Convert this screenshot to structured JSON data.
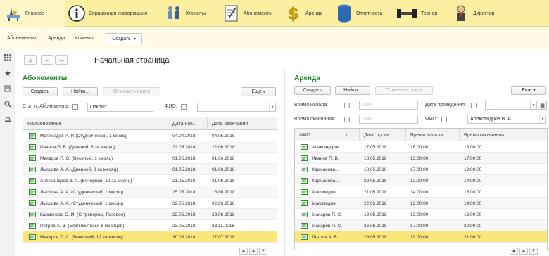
{
  "topnav": [
    {
      "label": "Главное",
      "icon": "home-desk-icon"
    },
    {
      "label": "Справочная информация",
      "icon": "info-icon"
    },
    {
      "label": "Клиенты",
      "icon": "clients-icon"
    },
    {
      "label": "Абонементы",
      "icon": "document-icon"
    },
    {
      "label": "Аренда",
      "icon": "dollar-icon"
    },
    {
      "label": "Отчетность",
      "icon": "database-icon"
    },
    {
      "label": "Тренер",
      "icon": "dumbbell-icon"
    },
    {
      "label": "Директор",
      "icon": "director-icon"
    }
  ],
  "subnav": {
    "items": [
      "Абонементы",
      "Аренда",
      "Клиенты"
    ],
    "create_label": "Создать"
  },
  "page": {
    "title": "Начальная страница"
  },
  "abon": {
    "title": "Абонементы",
    "create": "Создать",
    "find": "Найти...",
    "cancel": "Отменить поиск",
    "more": "Еще",
    "status_label": "Статус Абонемента:",
    "status_value": "Открыт",
    "fio_label": "ФИО:",
    "columns": [
      "Наименование",
      "Дата нач...",
      "Дата окончания"
    ],
    "rows": [
      [
        "Магомедов А. Р. (Студенческий, 1 месяц)",
        "04.04.2018",
        "04.05.2018"
      ],
      [
        "Иванов П. В. (Дневной, 8 за месяц)",
        "22.05.2018",
        "22.06.2018"
      ],
      [
        "Макаров П. С. (Веселый, 1 месяц)",
        "01.05.2018",
        "01.06.2018"
      ],
      [
        "Лысцова А. А. (Дневной, 8 за месяц)",
        "01.05.2018",
        "01.06.2018"
      ],
      [
        "Александров В. А. (Вечерний, 12 за месяц)",
        "21.05.2018",
        "21.06.2018"
      ],
      [
        "Лысцова А. А. (Студенческий, 1 месяц)",
        "15.05.2018",
        "15.06.2018"
      ],
      [
        "Лысцова А. А. (Студенческий, 1 месяц)",
        "02.05.2018",
        "02.06.2018"
      ],
      [
        "Карманова О. И. (С тренером, Разовое)",
        "22.05.2018",
        "22.06.2018"
      ],
      [
        "Петров А. В. (Безлимитный, 6 месяцев)",
        "23.05.2018",
        "23.11.2018"
      ],
      [
        "Макаров П. С. (Вечерний, 12 за месяц)",
        "30.06.2018",
        "27.07.2018"
      ]
    ],
    "selected_row": 9
  },
  "rent": {
    "title": "Аренда",
    "create": "Создать",
    "find": "Найти...",
    "cancel": "Отменить поиск",
    "more": "Еще",
    "time_start_label": "Время начала:",
    "time_end_label": "Время окончания:",
    "date_label": "Дата проведения:",
    "fio_label": "ФИО:",
    "time_placeholder": "0:00",
    "date_placeholder": ". .",
    "fio_value": "Александров В. А.",
    "columns": [
      "ФИО",
      "Дата прове...",
      "Время начала",
      "Время окончания"
    ],
    "rows": [
      [
        "Александров...",
        "17.05.2018",
        "16:00:00",
        "18:00:00"
      ],
      [
        "Иванов П. В.",
        "18.05.2018",
        "13:00:00",
        "17:00:00"
      ],
      [
        "Карманова...",
        "18.05.2018",
        "17:00:00",
        "19:00:00"
      ],
      [
        "Карманова...",
        "22.05.2018",
        "12:00:00",
        "14:00:00"
      ],
      [
        "Магомедов...",
        "21.05.2018",
        "14:00:00",
        "15:00:00"
      ],
      [
        "Магомедов",
        "22.05.2018",
        "12:00:00",
        "14:00:00"
      ],
      [
        "Макаров П. С.",
        "18.05.2018",
        "12:00:00",
        "16:00:00"
      ],
      [
        "Макаров П. С.",
        "26.05.2018",
        "17:00:00",
        "20:00:00"
      ],
      [
        "Петров А. В.",
        "29.05.2018",
        "19:00:00",
        "21:00:00"
      ]
    ],
    "selected_row": 8
  },
  "colors": {
    "accent": "#1f8a2e",
    "topbar": "#fcefa1",
    "selected": "#fbe67a"
  }
}
